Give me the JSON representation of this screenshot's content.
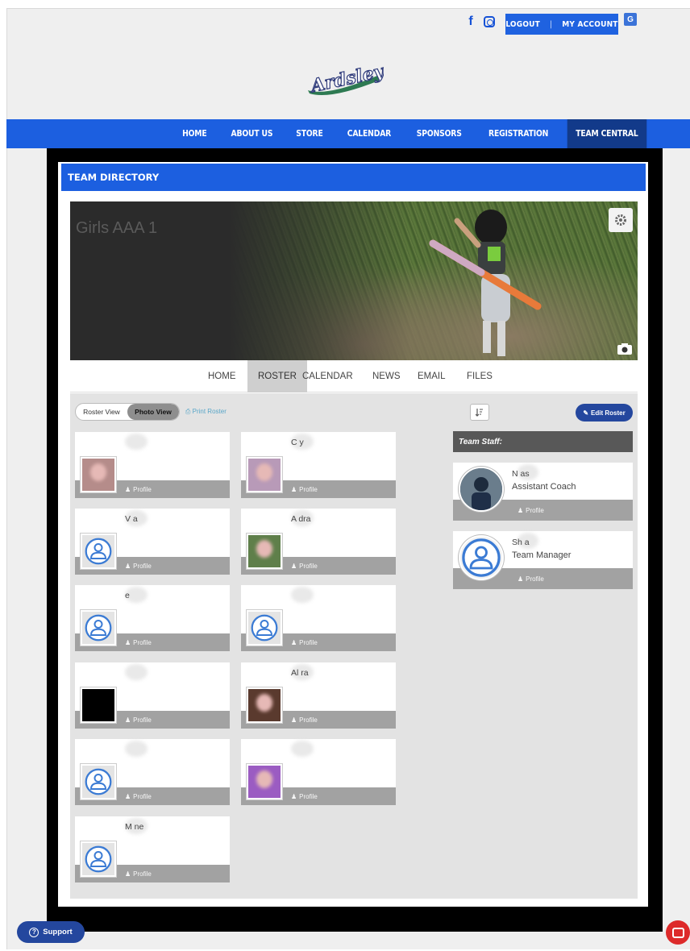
{
  "header": {
    "social": {
      "facebook_icon": "f"
    },
    "account": {
      "logout": "LOGOUT",
      "separator": "|",
      "my_account": "MY ACCOUNT"
    },
    "translate_icon": "G"
  },
  "logo": {
    "text": "Ardsley"
  },
  "nav": {
    "items": [
      {
        "label": "HOME"
      },
      {
        "label": "ABOUT US"
      },
      {
        "label": "STORE"
      },
      {
        "label": "CALENDAR"
      },
      {
        "label": "SPONSORS"
      },
      {
        "label": "REGISTRATION"
      },
      {
        "label": "TEAM CENTRAL",
        "active": true
      }
    ]
  },
  "directory": {
    "title": "TEAM DIRECTORY"
  },
  "team": {
    "name": "Girls AAA 1"
  },
  "tabs": [
    {
      "label": "HOME"
    },
    {
      "label": "ROSTER",
      "active": true
    },
    {
      "label": "CALENDAR"
    },
    {
      "label": "NEWS"
    },
    {
      "label": "EMAIL"
    },
    {
      "label": "FILES"
    }
  ],
  "roster": {
    "view_toggle": {
      "roster_view": "Roster View",
      "photo_view": "Photo View",
      "selected": "Photo View"
    },
    "print_label": "Print Roster",
    "edit_label": "Edit Roster",
    "profile_label": "Profile",
    "players": [
      {
        "name": "",
        "photo": "photo"
      },
      {
        "name": "C      y",
        "photo": "photo"
      },
      {
        "name": "V      a",
        "photo": "avatar"
      },
      {
        "name": "A      dra",
        "photo": "photo"
      },
      {
        "name": "       e",
        "photo": "avatar"
      },
      {
        "name": "",
        "photo": "avatar"
      },
      {
        "name": "",
        "photo": "black"
      },
      {
        "name": "Al      ra",
        "photo": "photo"
      },
      {
        "name": "",
        "photo": "avatar"
      },
      {
        "name": "",
        "photo": "photo"
      },
      {
        "name": "M      ne",
        "photo": "avatar"
      }
    ]
  },
  "staff": {
    "heading": "Team Staff:",
    "members": [
      {
        "name": "N      as",
        "role": "Assistant Coach",
        "photo": "photo"
      },
      {
        "name": "Sh      a",
        "role": "Team Manager",
        "photo": "avatar"
      }
    ],
    "profile_label": "Profile"
  },
  "support": {
    "label": "Support"
  },
  "colors": {
    "brand_blue": "#1c5fe0",
    "dark_blue": "#24479e",
    "active_nav": "#123a8a"
  }
}
